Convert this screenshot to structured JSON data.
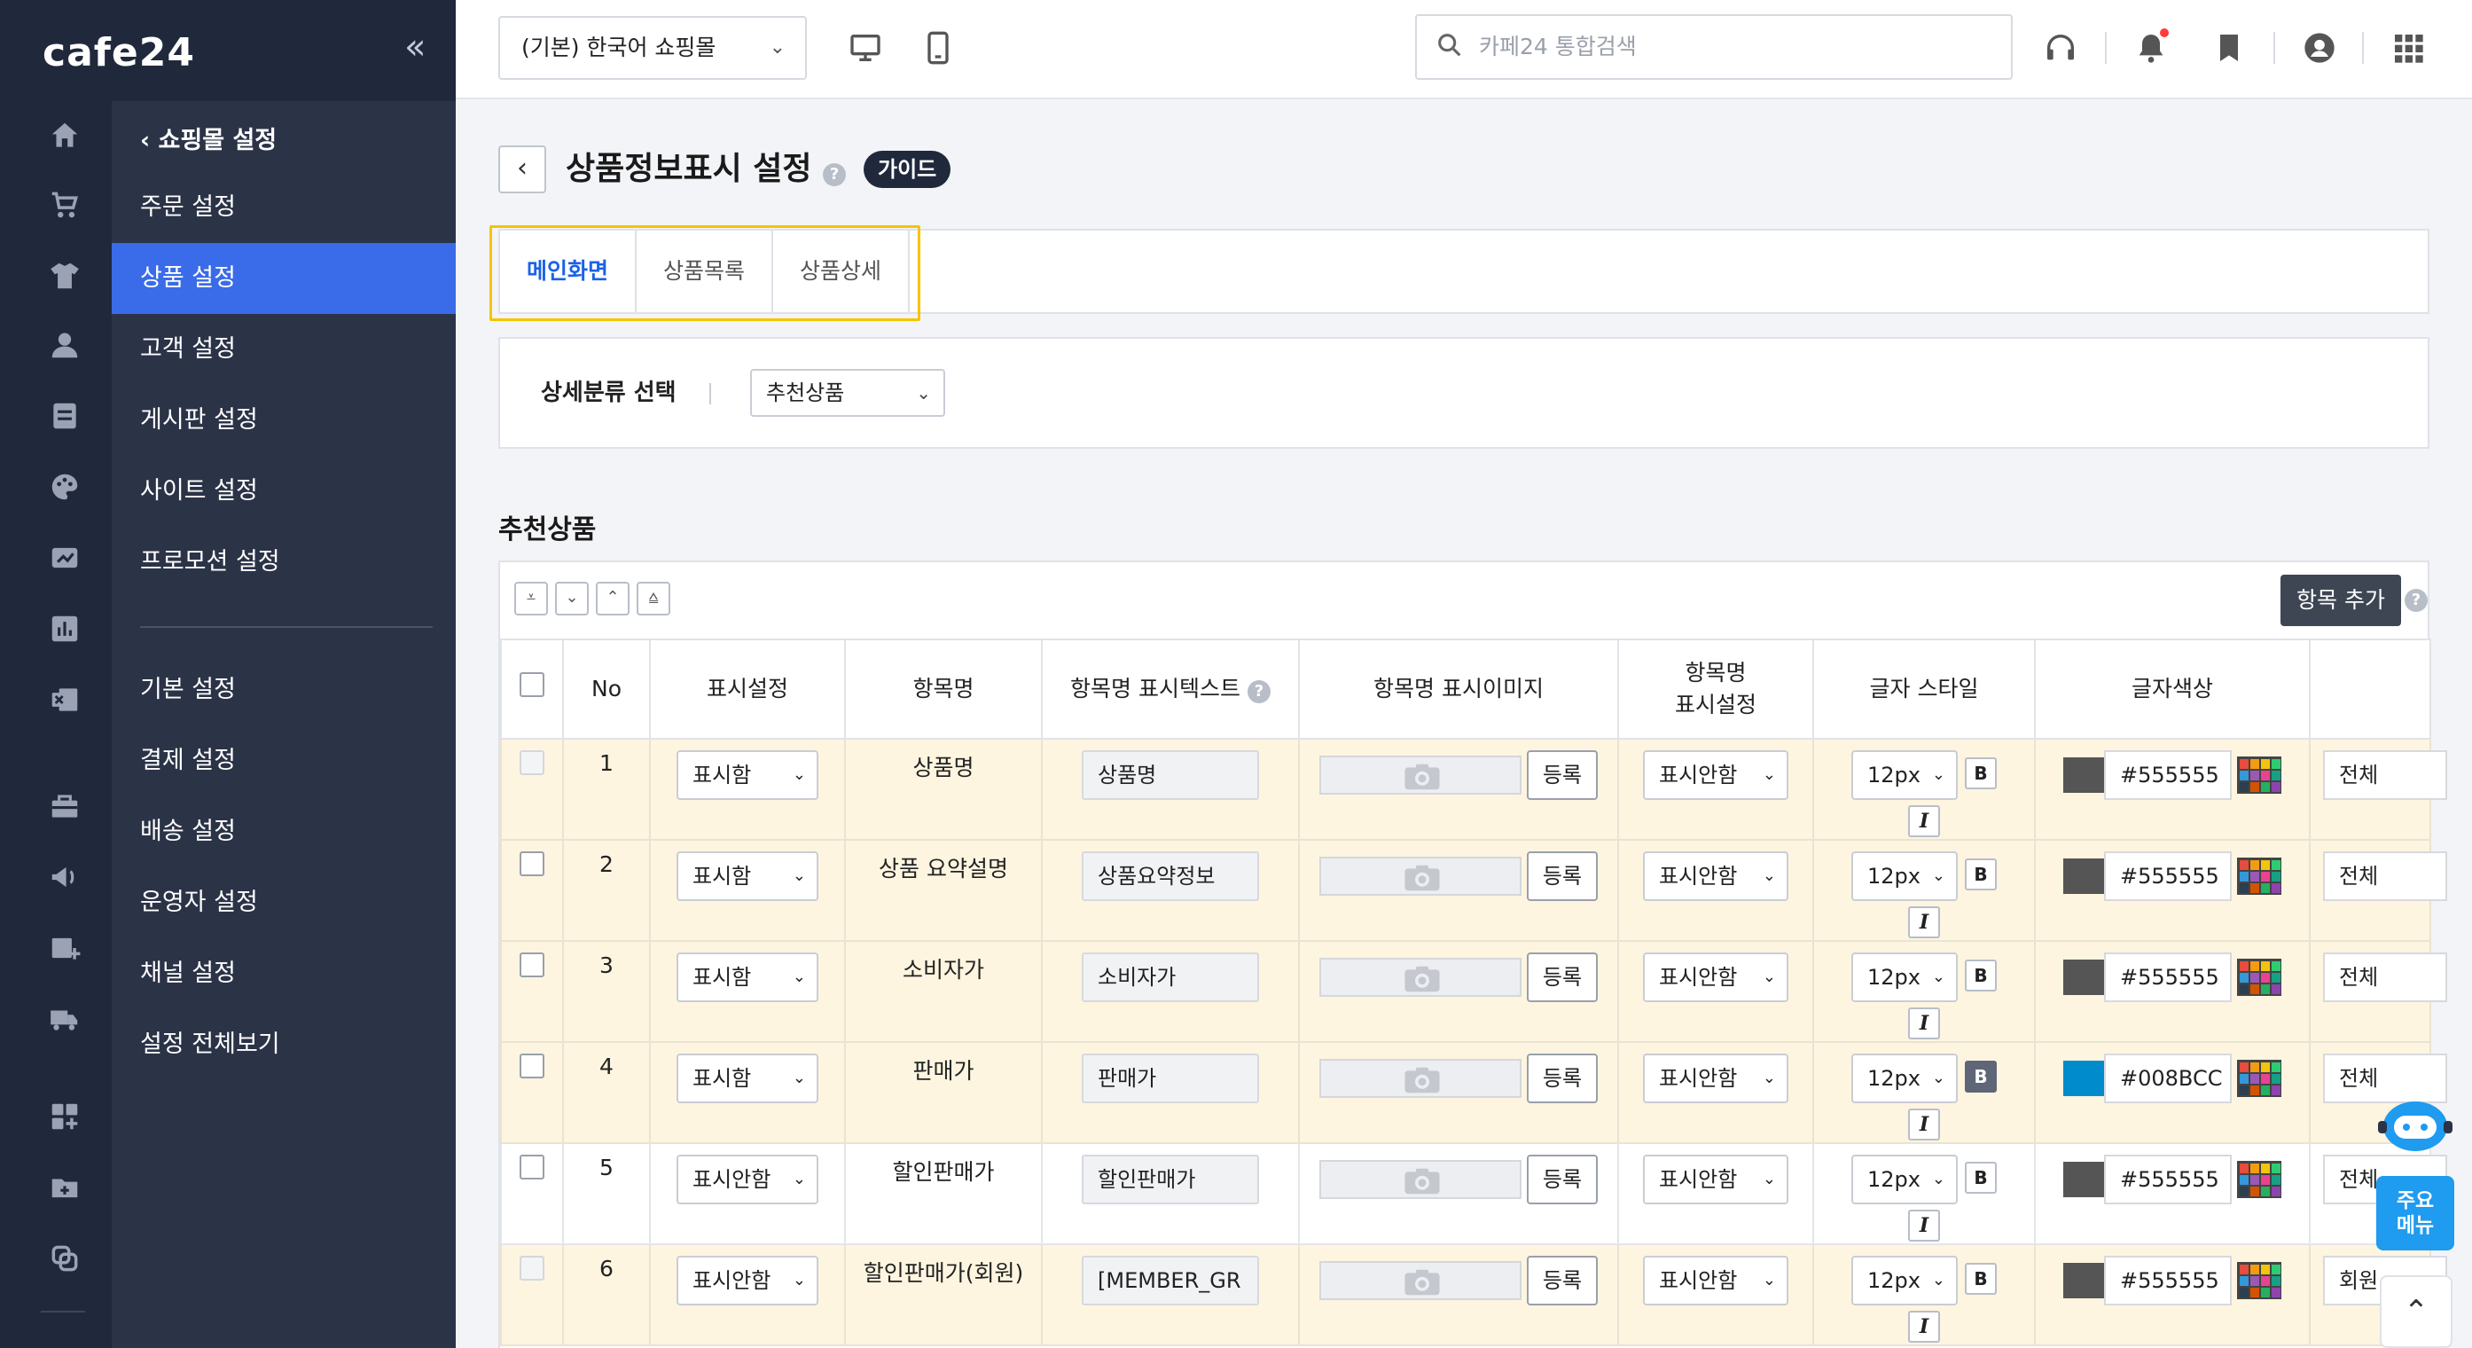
{
  "brand": {
    "logo": "cafe24",
    "collapse_label": "«"
  },
  "rail_icons": [
    "home-icon",
    "cart-icon",
    "tshirt-icon",
    "user-icon",
    "board-icon",
    "palette-icon",
    "promotion-icon",
    "stats-icon",
    "excel-icon",
    "store-icon",
    "megaphone-icon",
    "calendar-add-icon",
    "truck-icon",
    "apps-add-icon",
    "folder-add-icon",
    "copy-icon"
  ],
  "menu": {
    "back_label": "쇼핑몰 설정",
    "items": [
      "주문 설정",
      "상품 설정",
      "고객 설정",
      "게시판 설정",
      "사이트 설정",
      "프로모션 설정"
    ],
    "items2": [
      "기본 설정",
      "결제 설정",
      "배송 설정",
      "운영자 설정",
      "채널 설정",
      "설정 전체보기"
    ],
    "active": "상품 설정"
  },
  "topbar": {
    "mall_select": "(기본) 한국어 쇼핑몰",
    "search_placeholder": "카페24 통합검색"
  },
  "page": {
    "title": "상품정보표시 설정",
    "guide_label": "가이드",
    "tabs": [
      "메인화면",
      "상품목록",
      "상품상세"
    ],
    "active_tab": "메인화면",
    "filter_label": "상세분류 선택",
    "filter_value": "추천상품",
    "section_title": "추천상품",
    "add_button": "항목 추가"
  },
  "table": {
    "headers": {
      "no": "No",
      "display": "표시설정",
      "name": "항목명",
      "name_text": "항목명 표시텍스트",
      "name_image": "항목명 표시이미지",
      "name_display_1": "항목명",
      "name_display_2": "표시설정",
      "font_style": "글자 스타일",
      "font_color": "글자색상"
    },
    "register_label": "등록",
    "rows": [
      {
        "no": "1",
        "display": "표시함",
        "name": "상품명",
        "text": "상품명",
        "name_display": "표시안함",
        "size": "12px",
        "bold": "B",
        "italic": "I",
        "color": "#555555",
        "color_text": "#555555",
        "scope": "전체"
      },
      {
        "no": "2",
        "display": "표시함",
        "name": "상품 요약설명",
        "text": "상품요약정보",
        "name_display": "표시안함",
        "size": "12px",
        "bold": "B",
        "italic": "I",
        "color": "#555555",
        "color_text": "#555555",
        "scope": "전체"
      },
      {
        "no": "3",
        "display": "표시함",
        "name": "소비자가",
        "text": "소비자가",
        "name_display": "표시안함",
        "size": "12px",
        "bold": "B",
        "italic": "I",
        "color": "#555555",
        "color_text": "#555555",
        "scope": "전체"
      },
      {
        "no": "4",
        "display": "표시함",
        "name": "판매가",
        "text": "판매가",
        "name_display": "표시안함",
        "size": "12px",
        "bold": "B",
        "italic": "I",
        "color": "#008BCC",
        "color_text": "#008BCC",
        "scope": "전체"
      },
      {
        "no": "5",
        "display": "표시안함",
        "name": "할인판매가",
        "text": "할인판매가",
        "name_display": "표시안함",
        "size": "12px",
        "bold": "B",
        "italic": "I",
        "color": "#555555",
        "color_text": "#555555",
        "scope": "전체"
      },
      {
        "no": "6",
        "display": "표시안함",
        "name": "할인판매가(회원)",
        "text": "[MEMBER_GR",
        "name_display": "표시안함",
        "size": "12px",
        "bold": "B",
        "italic": "I",
        "color": "#555555",
        "color_text": "#555555",
        "scope": "회원"
      }
    ]
  },
  "floating": {
    "main_menu_1": "주요",
    "main_menu_2": "메뉴"
  },
  "colors": {
    "accent": "#3a6ce9",
    "tab_active": "#1b62e6",
    "highlight": "#f5c400",
    "sidebar": "#20293c"
  }
}
